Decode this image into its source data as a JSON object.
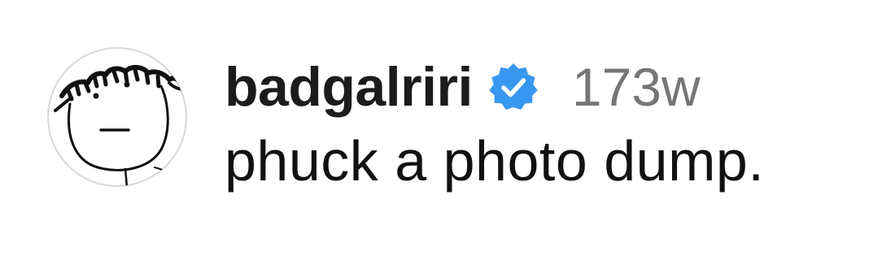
{
  "comment": {
    "username": "badgalriri",
    "verified": true,
    "timestamp": "173w",
    "text": "phuck a photo dump.",
    "avatar_icon": "hand-drawn-face-avatar",
    "verified_icon": "verified-badge-icon",
    "colors": {
      "verified_badge": "#3897f0",
      "username": "#1c1c1c",
      "timestamp": "#767676",
      "text": "#111111"
    }
  }
}
